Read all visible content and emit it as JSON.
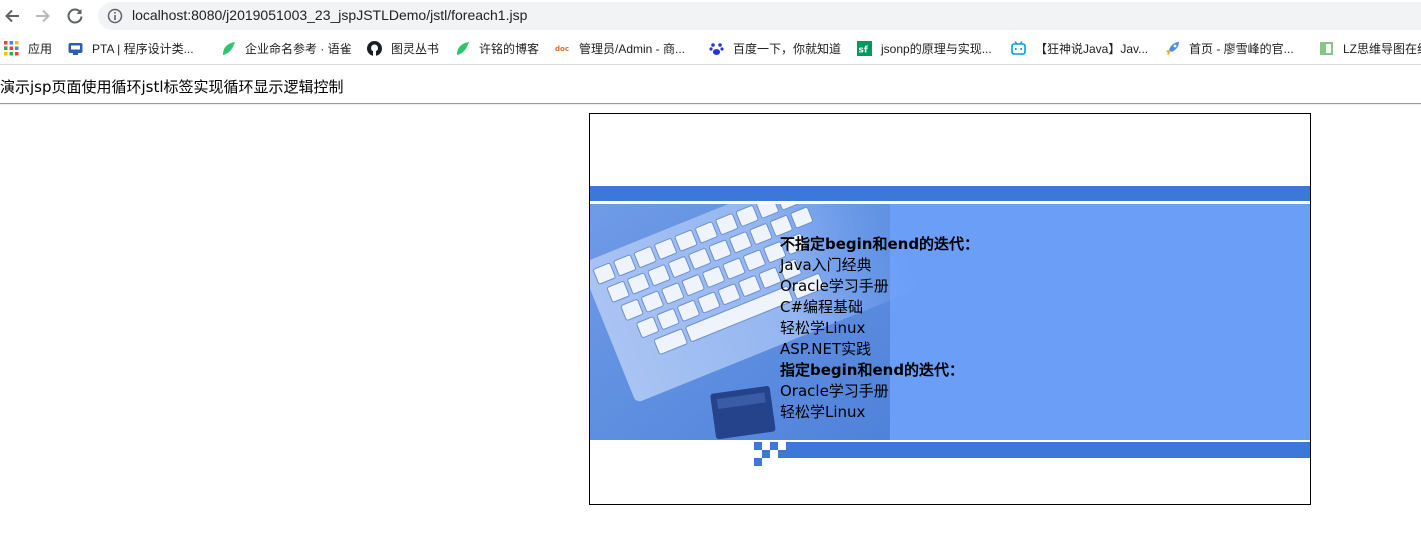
{
  "browser": {
    "url": "localhost:8080/j2019051003_23_jspJSTLDemo/jstl/foreach1.jsp",
    "bookmarks": [
      {
        "label": "应用",
        "icon": "apps-grid-icon"
      },
      {
        "label": "PTA | 程序设计类...",
        "icon": "pta-icon"
      },
      {
        "label": "企业命名参考 · 语雀",
        "icon": "yuque-icon"
      },
      {
        "label": "图灵丛书",
        "icon": "github-icon"
      },
      {
        "label": "许铭的博客",
        "icon": "yuque-icon"
      },
      {
        "label": "管理员/Admin - 商...",
        "icon": "doc-icon"
      },
      {
        "label": "百度一下，你就知道",
        "icon": "baidu-paw-icon"
      },
      {
        "label": "jsonp的原理与实现...",
        "icon": "segmentfault-icon"
      },
      {
        "label": "【狂神说Java】Jav...",
        "icon": "bilibili-icon"
      },
      {
        "label": "首页 - 廖雪峰的官...",
        "icon": "rocket-icon"
      },
      {
        "label": "LZ思维导图在线",
        "icon": "mindmap-icon"
      }
    ]
  },
  "page": {
    "title": "演示jsp页面使用循环jstl标签实现循环显示逻辑控制",
    "section1_heading": "不指定begin和end的迭代：",
    "section1_items": [
      "Java入门经典",
      "Oracle学习手册",
      "C#编程基础",
      "轻松学Linux",
      "ASP.NET实践"
    ],
    "section2_heading": "指定begin和end的迭代：",
    "section2_items": [
      "Oracle学习手册",
      "轻松学Linux"
    ]
  },
  "colors": {
    "banner_blue": "#6a9ef7",
    "band_blue": "#3b78d8"
  }
}
